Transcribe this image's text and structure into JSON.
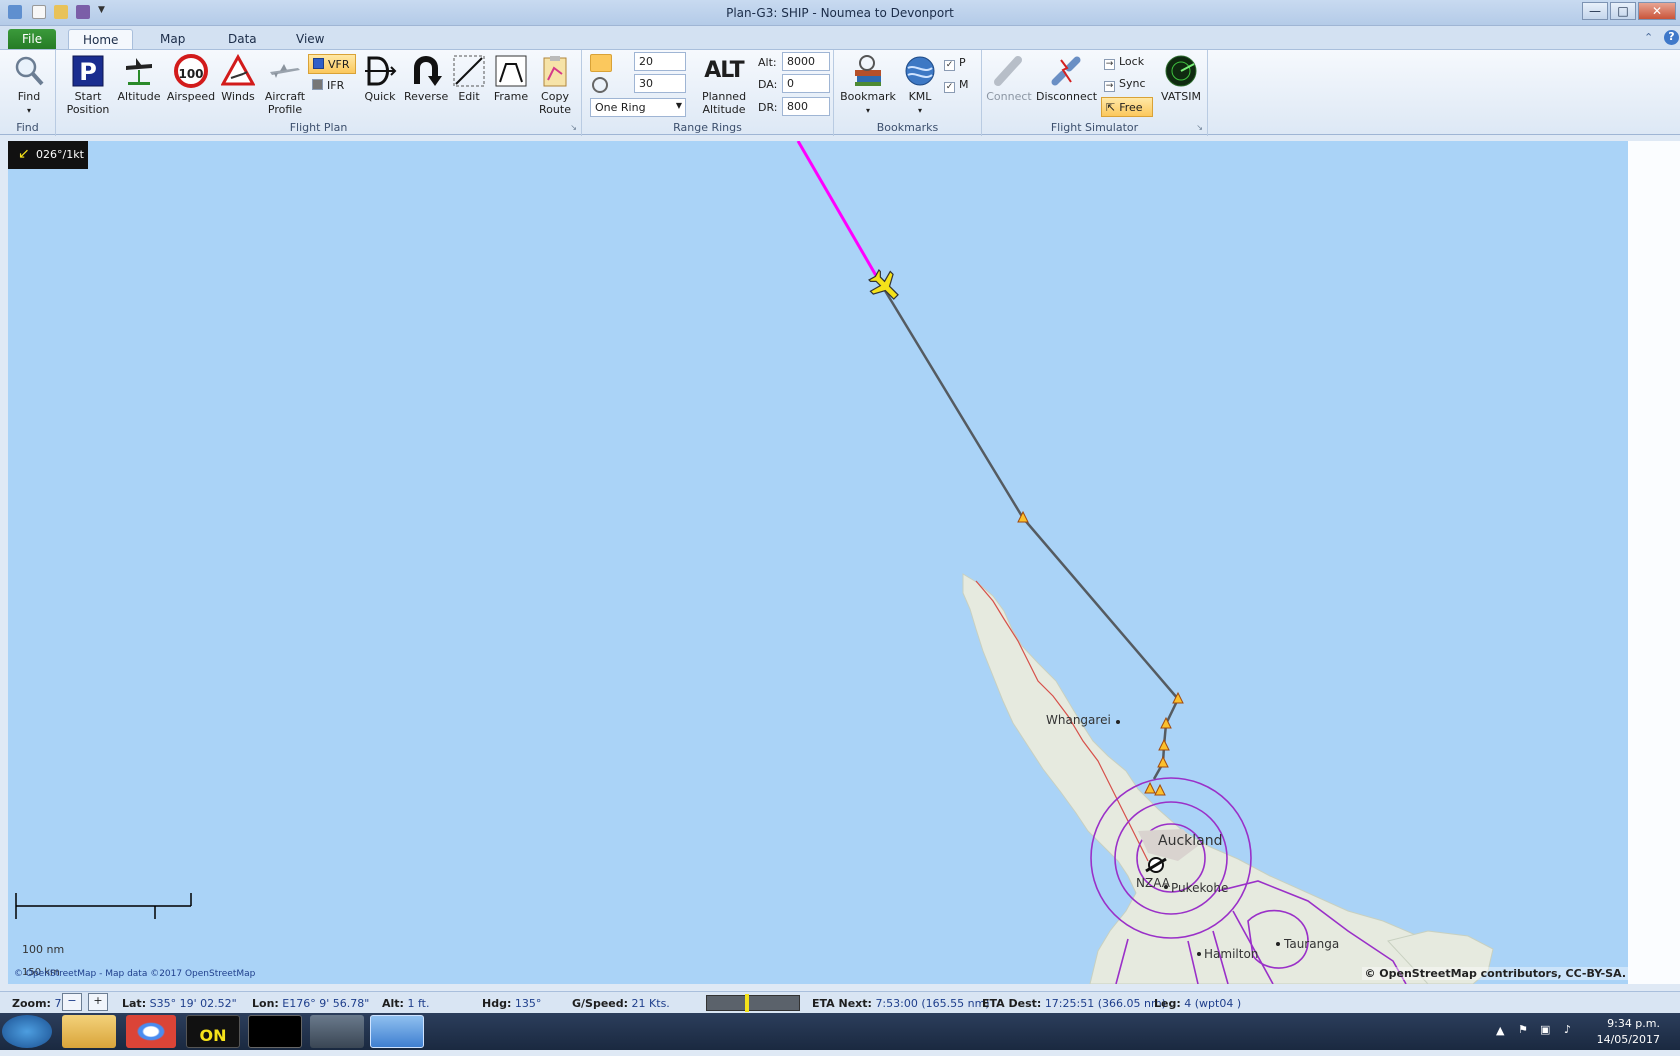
{
  "window": {
    "title": "Plan-G3: SHIP - Noumea to Devonport",
    "minimize": "—",
    "maximize": "□",
    "close": "✕"
  },
  "tabs": [
    {
      "label": "File"
    },
    {
      "label": "Home"
    },
    {
      "label": "Map"
    },
    {
      "label": "Data"
    },
    {
      "label": "View"
    }
  ],
  "ribbon": {
    "find": {
      "button": "Find",
      "group": "Find"
    },
    "flight_plan": {
      "group": "Flight Plan",
      "start_position": "Start Position",
      "altitude": "Altitude",
      "airspeed": "Airspeed",
      "airspeed_sign": "100",
      "winds": "Winds",
      "aircraft_profile": "Aircraft Profile",
      "vfr": "VFR",
      "ifr": "IFR",
      "quick": "Quick",
      "reverse": "Reverse",
      "edit": "Edit",
      "frame": "Frame",
      "copy_route": "Copy Route"
    },
    "range_rings": {
      "group": "Range Rings",
      "value1": "20",
      "value2": "30",
      "mode": "One Ring",
      "planned_altitude": "Planned Altitude",
      "alt_icon": "ALT",
      "alt_label": "Alt:",
      "alt_value": "8000",
      "da_label": "DA:",
      "da_value": "0",
      "dr_label": "DR:",
      "dr_value": "800"
    },
    "bookmarks": {
      "group": "Bookmarks",
      "bookmark": "Bookmark",
      "kml": "KML",
      "p": "P",
      "m": "M"
    },
    "flight_simulator": {
      "group": "Flight Simulator",
      "connect": "Connect",
      "disconnect": "Disconnect",
      "lock": "Lock",
      "sync": "Sync",
      "free": "Free",
      "vatsim": "VATSIM"
    }
  },
  "map": {
    "wind": "026°/1kt",
    "labels": {
      "whangarei": "Whangarei",
      "auckland": "Auckland",
      "nzaa": "NZAA",
      "pukekohe": "Pukekohe",
      "hamilton": "Hamilton",
      "tauranga": "Tauranga"
    },
    "scale_nm": "100 nm",
    "scale_km": "150 km",
    "attribution_left": "© OpenStreetMap - Map data ©2017 OpenStreetMap",
    "attribution_right": "© OpenStreetMap contributors, CC-BY-SA."
  },
  "status": {
    "zoom_label": "Zoom:",
    "zoom_value": "7",
    "zoom_minus": "−",
    "zoom_plus": "+",
    "lat_label": "Lat:",
    "lat_value": "S35° 19' 02.52\"",
    "lon_label": "Lon:",
    "lon_value": "E176° 9' 56.78\"",
    "alt_label": "Alt:",
    "alt_value": "1 ft.",
    "hdg_label": "Hdg:",
    "hdg_value": "135°",
    "gs_label": "G/Speed:",
    "gs_value": "21 Kts.",
    "eta_next_label": "ETA Next:",
    "eta_next_value": "7:53:00 (165.55 nm)",
    "eta_dest_label": "ETA Dest:",
    "eta_dest_value": "17:25:51 (366.05 nm)",
    "leg_label": "Leg:",
    "leg_value": "4 (wpt04 )"
  },
  "taskbar": {
    "time": "9:34 p.m.",
    "date": "14/05/2017",
    "on_label": "ON"
  },
  "colors": {
    "sea": "#aad3f7",
    "land": "#e6eadf",
    "route_flown": "#ff00ff",
    "route_planned": "#555b61",
    "airspace": "#9a30c8",
    "aircraft": "#f5e21a"
  }
}
